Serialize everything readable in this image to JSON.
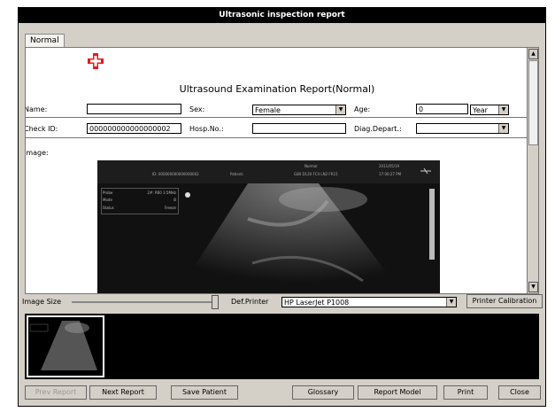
{
  "window": {
    "title": "Ultrasonic inspection report"
  },
  "tabs": [
    {
      "label": "Normal"
    }
  ],
  "report": {
    "title": "Ultrasound Examination Report(Normal)",
    "fields": {
      "name_label": "Name:",
      "name_value": "",
      "sex_label": "Sex:",
      "sex_value": "Female",
      "age_label": "Age:",
      "age_value": "0",
      "age_unit": "Year",
      "check_id_label": "Check ID:",
      "check_id_value": "000000000000000002",
      "hosp_no_label": "Hosp.No.:",
      "hosp_no_value": "",
      "diag_depart_label": "Diag.Depart.:",
      "diag_depart_value": "",
      "image_label": "Image:"
    }
  },
  "ultrasound": {
    "id_text": "ID: 000000000000000002",
    "patient_text": "Patient:",
    "mode_name": "Normal",
    "params": "G80  D120  FC4  LN2  FR15",
    "date": "2011/05/19",
    "time": "17:00:27 PM",
    "probe_label": "Probe",
    "probe_value": "2#: R60 3.5MHz",
    "mode_label": "Mode",
    "mode_value": "B",
    "status_label": "Status",
    "status_value": "Freeze"
  },
  "controls": {
    "image_size_label": "Image Size",
    "def_printer_label": "Def.Printer",
    "printer_value": "HP LaserJet P1008",
    "printer_calibration": "Printer Calibration"
  },
  "buttons": {
    "prev_report": "Prev Report",
    "next_report": "Next Report",
    "save_patient": "Save Patient",
    "glossary": "Glossary",
    "report_model": "Report Model",
    "print": "Print",
    "close": "Close"
  },
  "colors": {
    "titlebar": "#000000",
    "cross": "#e41b1b",
    "panel": "#d4d0c8"
  }
}
